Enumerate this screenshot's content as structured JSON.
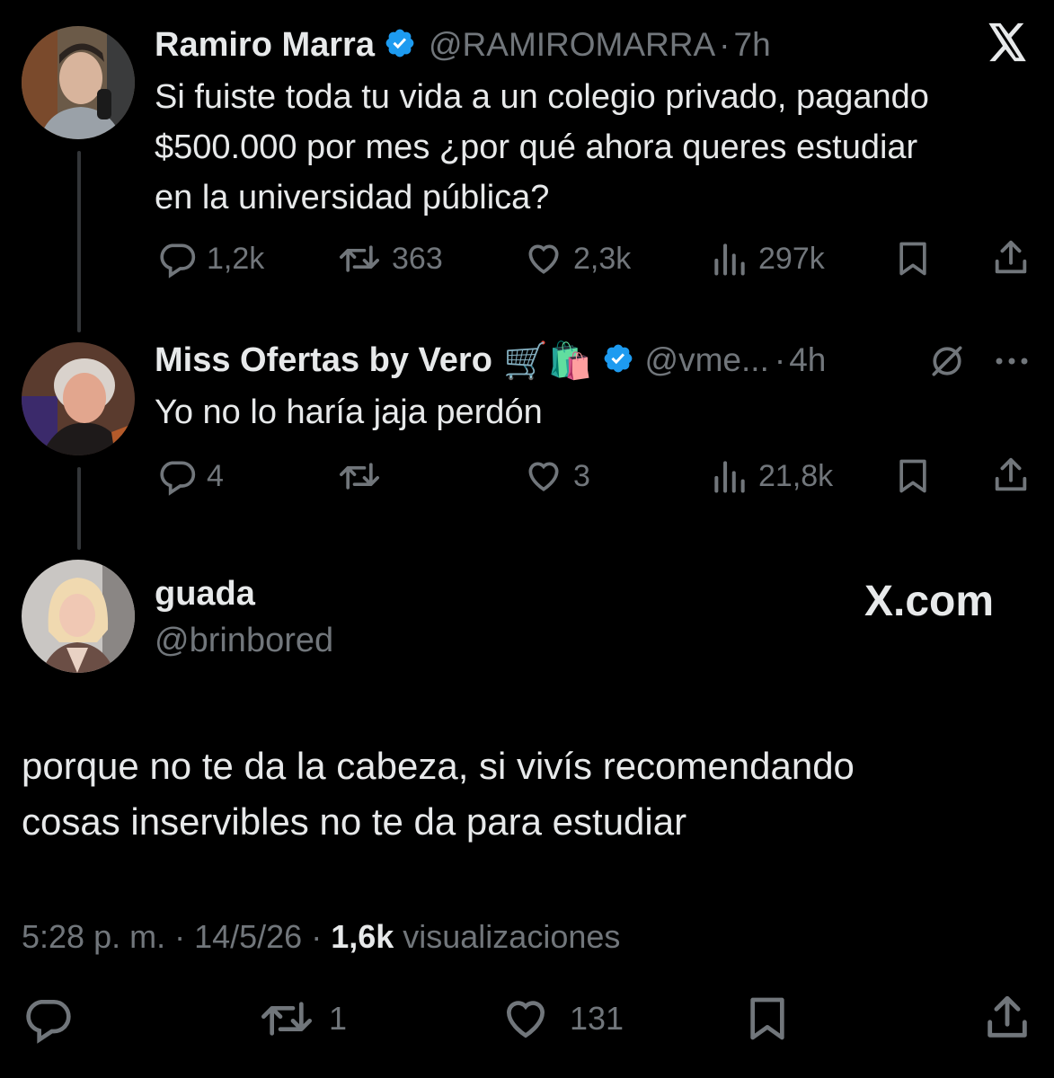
{
  "tweet1": {
    "name": "Ramiro Marra",
    "handle": "@RAMIROMARRA",
    "dot": "·",
    "time": "7h",
    "text_lines": [
      "Si fuiste toda tu vida a un colegio privado, pagando",
      "$500.000 por mes ¿por qué ahora queres estudiar",
      "en la universidad pública?"
    ],
    "replies": "1,2k",
    "reposts": "363",
    "likes": "2,3k",
    "views": "297k"
  },
  "tweet2": {
    "name": "Miss Ofertas by Vero",
    "emojis": "🛒🛍️",
    "handle": "@vme...",
    "dot": "·",
    "time": "4h",
    "text": "Yo no lo haría jaja perdón",
    "replies": "4",
    "reposts": "",
    "likes": "3",
    "views": "21,8k"
  },
  "tweet3": {
    "name": "guada",
    "handle": "@brinbored",
    "watermark": "X.com",
    "text_lines": [
      "porque no te da la cabeza, si vivís recomendando",
      "cosas inservibles no te da para estudiar"
    ],
    "meta_time": "5:28 p. m. · 14/5/26 ·",
    "meta_views_count": "1,6k",
    "meta_views_label": "visualizaciones",
    "reposts": "1",
    "likes": "131"
  },
  "colors": {
    "background": "#000000",
    "text": "#e7e9ea",
    "muted": "#71767b",
    "verified": "#1d9bf0",
    "line": "#333639"
  },
  "icons": [
    "x-logo-icon",
    "verified-badge-icon",
    "reply-icon",
    "repost-icon",
    "like-icon",
    "views-icon",
    "bookmark-icon",
    "share-icon",
    "grok-icon",
    "more-icon"
  ]
}
